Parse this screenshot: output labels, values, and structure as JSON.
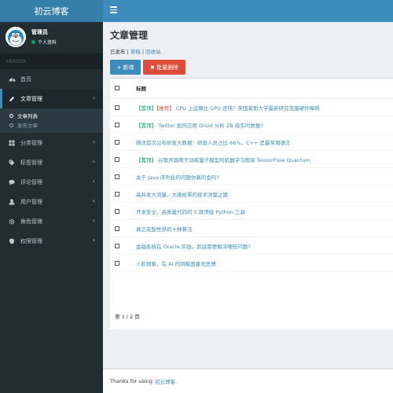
{
  "app": {
    "title": "初云博客"
  },
  "user": {
    "name": "管理员",
    "status": "个人资料"
  },
  "sidebar": {
    "header": "HEADER",
    "items": [
      {
        "label": "首页",
        "icon": "dashboard-icon"
      },
      {
        "label": "文章管理",
        "icon": "pencil-icon"
      },
      {
        "label": "分类管理",
        "icon": "grid-icon"
      },
      {
        "label": "标签管理",
        "icon": "tag-icon"
      },
      {
        "label": "评论管理",
        "icon": "comment-icon"
      },
      {
        "label": "用户管理",
        "icon": "user-icon"
      },
      {
        "label": "角色管理",
        "icon": "gear-icon"
      },
      {
        "label": "权限管理",
        "icon": "shield-icon"
      }
    ],
    "submenu": [
      {
        "label": "文章列表"
      },
      {
        "label": "发布文章"
      }
    ]
  },
  "page": {
    "title": "文章管理",
    "filter": {
      "current": "已发布",
      "sep1": " | ",
      "draft": "草稿",
      "sep2": " | ",
      "trash": "回收站"
    },
    "add_label": "+ 新增",
    "del_label": "✖ 批量删除",
    "table_header": "标题",
    "rows": [
      {
        "tag1": "【置顶】",
        "tag2": "【推荐】",
        "title": " CPU 上运算比 GPU 还快？美国莱斯大学最新研究克服硬件障碍"
      },
      {
        "tag1": "【置顶】",
        "tag2": "",
        "title": " Twitter 如何应用 Druid 分析 ZB 级实时数据?"
      },
      {
        "tag1": "",
        "tag2": "",
        "title": "腾讯首次公布研发大数据：研发人员占比 66%，C++ 是最常用语言"
      },
      {
        "tag1": "【置顶】",
        "tag2": "",
        "title": " 谷歌开源用于训练量子模型的机器学习框架 TensorFlow Quantum"
      },
      {
        "tag1": "",
        "tag2": "",
        "title": "关于 Java 序列化的问题你真的会吗?"
      },
      {
        "tag1": "",
        "tag2": "",
        "title": "高并发大流量，大唐抢票的技术涅槃之路"
      },
      {
        "tag1": "",
        "tag2": "",
        "title": "开发安全、高质量代码的 5 款顶级 Python 工具"
      },
      {
        "tag1": "",
        "tag2": "",
        "title": "真正支配世界的十种算法"
      },
      {
        "tag1": "",
        "tag2": "",
        "title": "金融系统在 Oracle 实践，到底需要解决哪些问题?"
      },
      {
        "tag1": "",
        "tag2": "",
        "title": "人脸搜索，在 AI 的阴暗面建无恶博"
      }
    ],
    "pager": "第 1 / 2 页"
  },
  "footer": {
    "text": "Thanks for using",
    "link": "初云博客."
  },
  "colors": {
    "brand": "#3c8dbc",
    "danger": "#dd4b39",
    "success": "#00a65a",
    "sidebar_bg": "#222d32"
  }
}
